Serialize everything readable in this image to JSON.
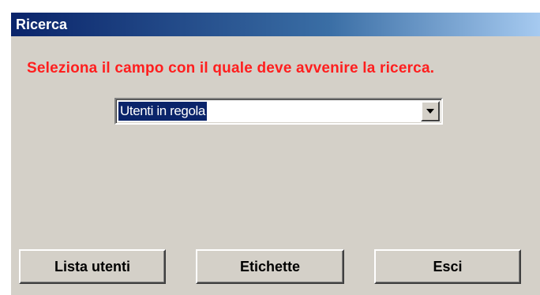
{
  "window": {
    "title": "Ricerca"
  },
  "prompt": {
    "text": "Seleziona il campo con il quale deve avvenire la ricerca."
  },
  "search_field": {
    "selected_value": "Utenti in regola",
    "arrow_icon": "chevron-down-icon"
  },
  "buttons": {
    "lista_utenti": "Lista utenti",
    "etichette": "Etichette",
    "esci": "Esci"
  },
  "colors": {
    "title_bar_start": "#0a246a",
    "title_bar_end": "#a6caf0",
    "prompt_text": "#ff1e1e",
    "dialog_background": "#d4d0c8",
    "selection_highlight": "#0a246a"
  }
}
